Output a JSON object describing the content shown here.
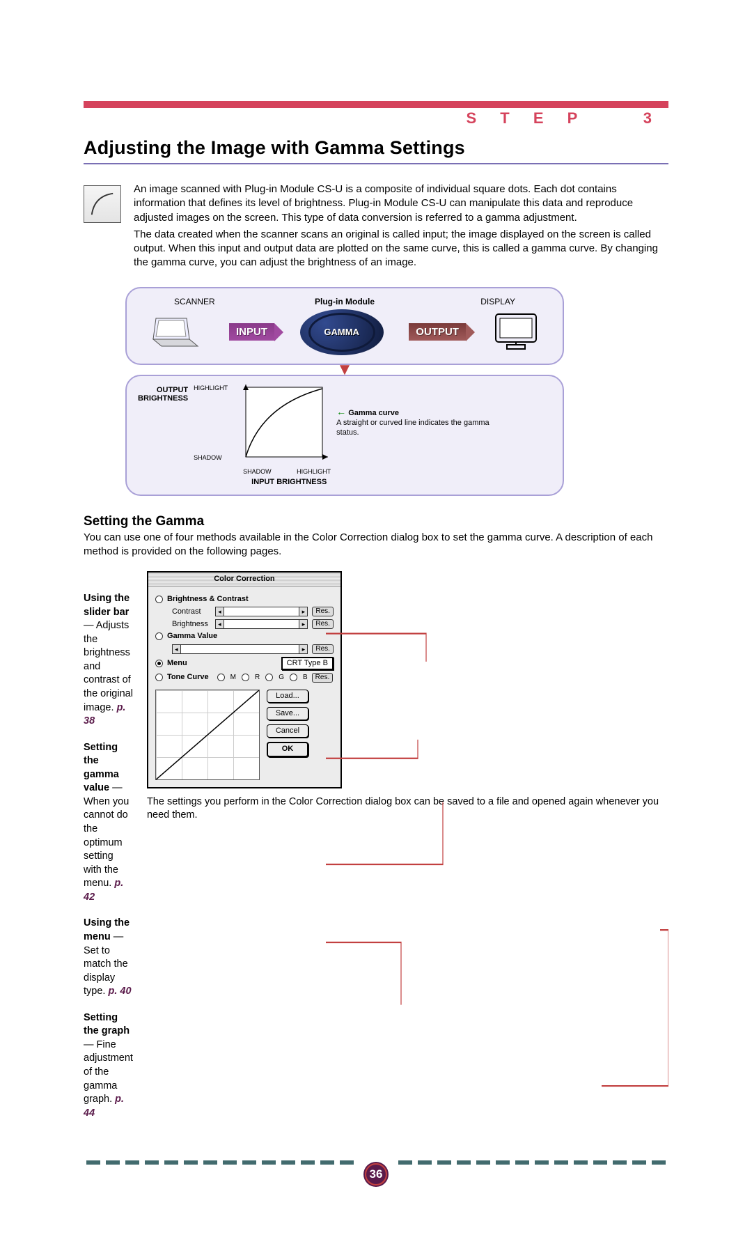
{
  "header": {
    "step_label": "S T E P",
    "step_num": "3",
    "title": "Adjusting the Image with Gamma Settings"
  },
  "intro": {
    "p1": "An image scanned with Plug-in Module CS-U is a composite of individual square dots. Each dot contains information that defines its level of brightness.  Plug-in Module CS-U can manipulate this data and reproduce adjusted images on the screen.  This type of data conversion is referred to a gamma adjustment.",
    "p2": "The data created when the scanner scans an original is called input; the image displayed on the screen is called output.  When this input and output data are plotted on the same curve, this is called a gamma curve.  By changing the gamma curve, you can adjust the brightness of an image."
  },
  "flow": {
    "scanner": "SCANNER",
    "plugin": "Plug-in Module",
    "display": "DISPLAY",
    "input": "INPUT",
    "gamma": "GAMMA",
    "output": "OUTPUT"
  },
  "curve": {
    "y_axis": "OUTPUT\nBRIGHTNESS",
    "y_high": "HIGHLIGHT",
    "y_low": "SHADOW",
    "x_low": "SHADOW",
    "x_high": "HIGHLIGHT",
    "x_axis": "INPUT BRIGHTNESS",
    "curve_title": "Gamma curve",
    "curve_desc": "A straight or curved line indicates the gamma status."
  },
  "section2_title": "Setting the Gamma",
  "section2_text": "You can use one of four methods available in the Color Correction dialog box to set the gamma curve. A description of each method is provided on the following pages.",
  "methods": [
    {
      "title": "Using the slider bar",
      "text": " — Adjusts the brightness and contrast of the original image.  ",
      "pref": "p. 38"
    },
    {
      "title": "Setting the gamma value",
      "text": " — When you cannot do the optimum setting with the menu.  ",
      "pref": "p. 42"
    },
    {
      "title": "Using the menu",
      "text": " — Set to match the display type.  ",
      "pref": "p. 40"
    },
    {
      "title": "Setting the graph",
      "text": " — Fine adjustment of the gamma graph.  ",
      "pref": "p. 44"
    }
  ],
  "dialog": {
    "title": "Color Correction",
    "brightness_contrast": "Brightness & Contrast",
    "contrast": "Contrast",
    "brightness": "Brightness",
    "gamma_value": "Gamma Value",
    "menu": "Menu",
    "menu_value": "CRT Type B",
    "tone_curve": "Tone Curve",
    "ch_m": "M",
    "ch_r": "R",
    "ch_g": "G",
    "ch_b": "B",
    "res": "Res.",
    "load": "Load...",
    "save": "Save...",
    "cancel": "Cancel",
    "ok": "OK"
  },
  "dialog_caption": "The settings you perform in the Color Correction dialog box can be saved to a file and opened again whenever you need them.",
  "page_number": "36"
}
